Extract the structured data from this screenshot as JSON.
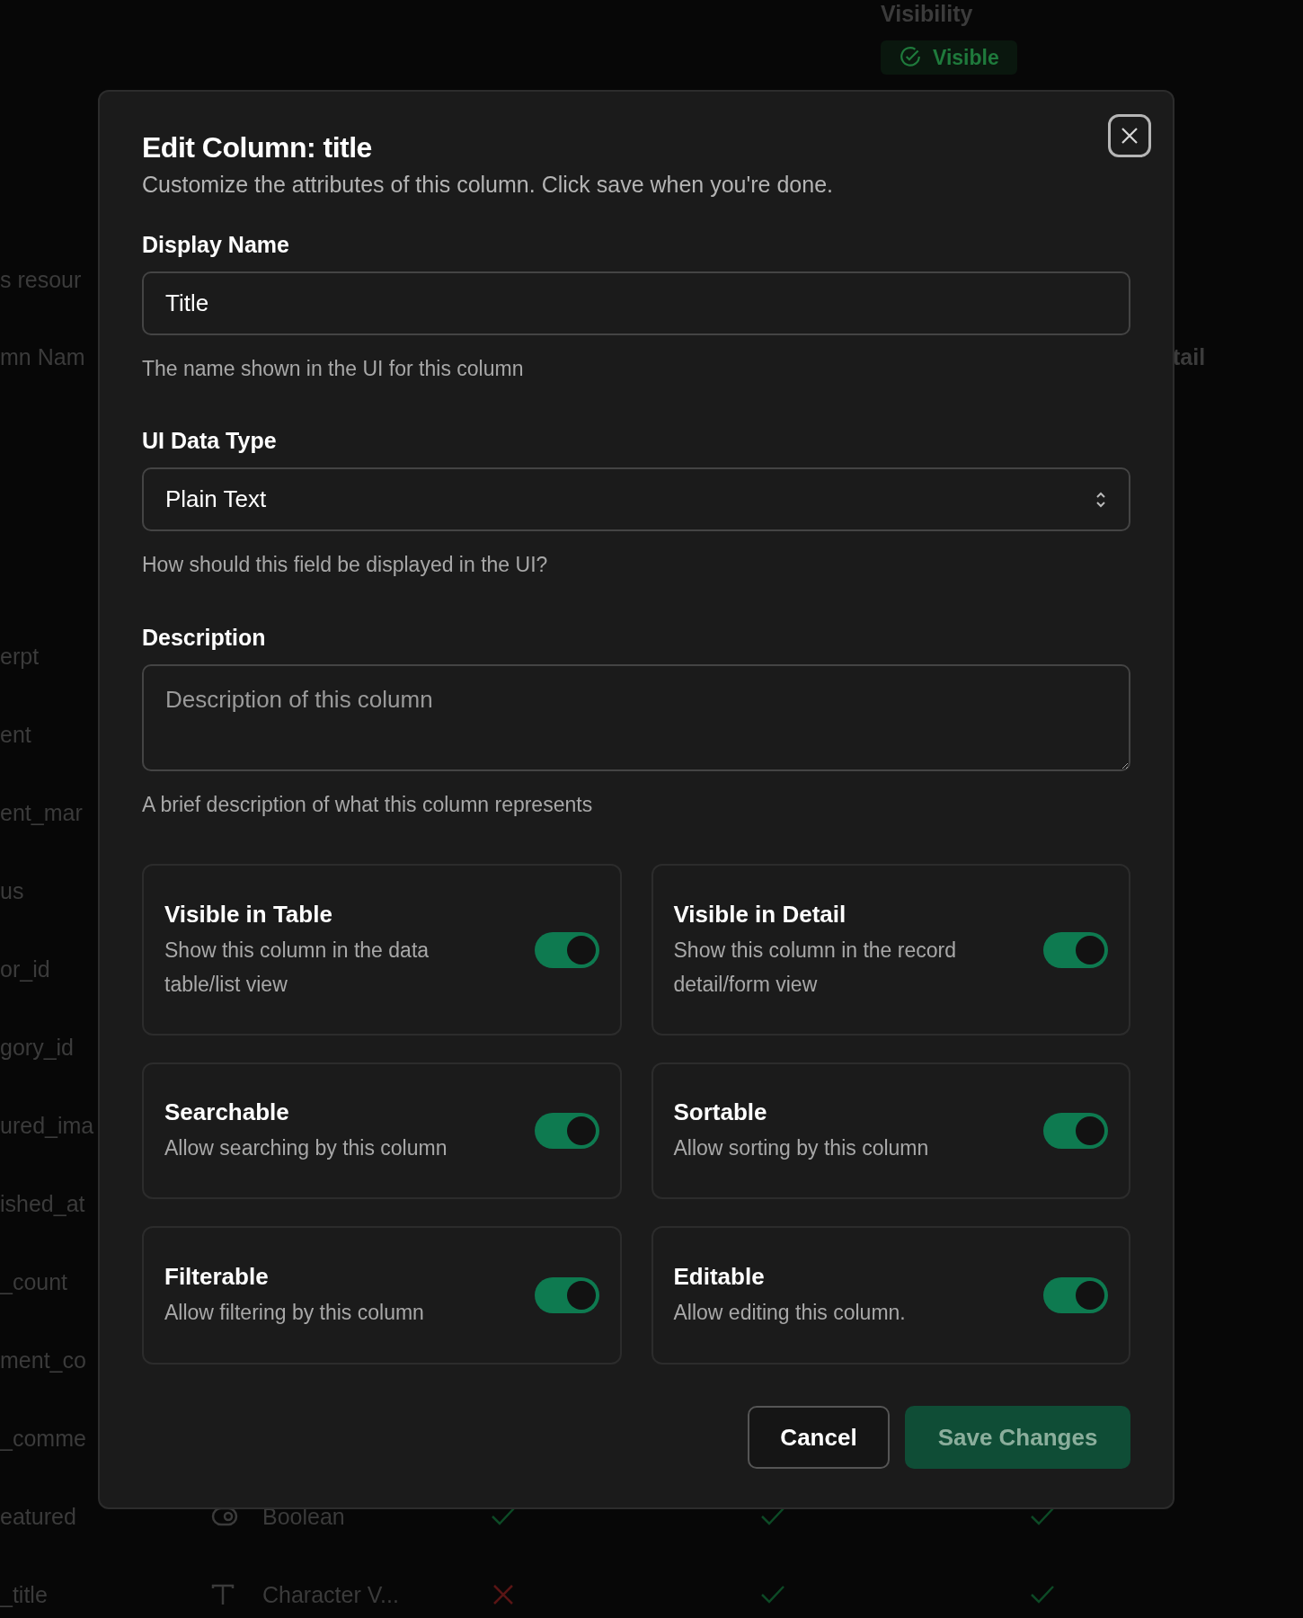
{
  "background": {
    "visibility_header": "Visibility",
    "visibility_badge": "Visible",
    "section_heading": "s resour",
    "column_header": "mn Nam",
    "detail_header": "tail",
    "column_names": [
      "erpt",
      "ent",
      "ent_mar",
      "us",
      "or_id",
      "gory_id",
      "ured_ima",
      "ished_at",
      "_count",
      "ment_co",
      "_comme",
      "eatured",
      "_title"
    ],
    "rows": [
      {
        "kind": "boolean",
        "type_label": "Boolean",
        "flags": [
          true,
          true,
          true
        ]
      },
      {
        "kind": "text",
        "type_label": "Character V...",
        "flags": [
          false,
          true,
          true
        ]
      }
    ]
  },
  "dialog": {
    "title": "Edit Column: title",
    "subtitle": "Customize the attributes of this column. Click save when you're done.",
    "display_name": {
      "label": "Display Name",
      "value": "Title",
      "help": "The name shown in the UI for this column"
    },
    "data_type": {
      "label": "UI Data Type",
      "value": "Plain Text",
      "help": "How should this field be displayed in the UI?"
    },
    "description": {
      "label": "Description",
      "placeholder": "Description of this column",
      "help": "A brief description of what this column represents"
    },
    "options": [
      {
        "title": "Visible in Table",
        "text": "Show this column in the data table/list view",
        "on": true
      },
      {
        "title": "Visible in Detail",
        "text": "Show this column in the record detail/form view",
        "on": true
      },
      {
        "title": "Searchable",
        "text": "Allow searching by this column",
        "on": true
      },
      {
        "title": "Sortable",
        "text": "Allow sorting by this column",
        "on": true
      },
      {
        "title": "Filterable",
        "text": "Allow filtering by this column",
        "on": true
      },
      {
        "title": "Editable",
        "text": "Allow editing this column.",
        "on": true
      }
    ],
    "cancel": "Cancel",
    "save": {
      "label": "Save Changes",
      "disabled": true
    }
  }
}
